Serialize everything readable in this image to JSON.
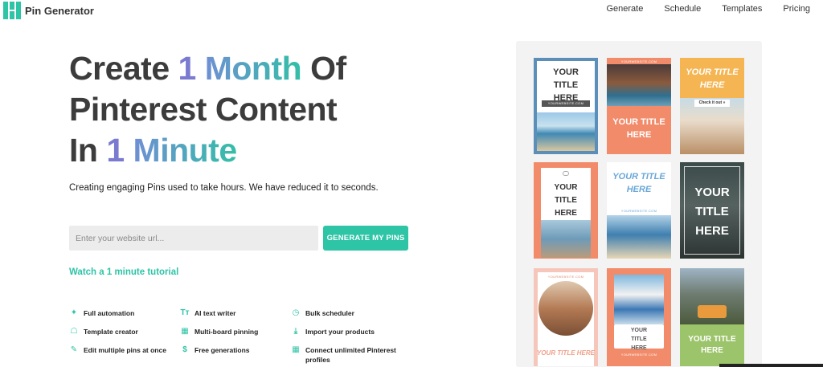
{
  "header": {
    "logo_text": "Pin Generator",
    "nav": [
      "Generate",
      "Schedule",
      "Templates",
      "Pricing"
    ]
  },
  "hero": {
    "line1": {
      "pre": "Create ",
      "num": "1",
      "word": "Month",
      "post": " Of"
    },
    "line2": "Pinterest Content",
    "line3": {
      "pre": "In ",
      "num": "1",
      "word": "Minute"
    },
    "subtitle": "Creating engaging Pins used to take hours. We have reduced it to seconds.",
    "url_placeholder": "Enter your website url...",
    "generate_label": "GENERATE MY PINS",
    "tutorial_link": "Watch a 1 minute tutorial"
  },
  "features": [
    {
      "icon": "android-icon",
      "glyph": "✦",
      "label": "Full automation"
    },
    {
      "icon": "text-icon",
      "glyph": "Tт",
      "label": "AI text writer"
    },
    {
      "icon": "clock-icon",
      "glyph": "◷",
      "label": "Bulk scheduler"
    },
    {
      "icon": "person-icon",
      "glyph": "☖",
      "label": "Template creator"
    },
    {
      "icon": "grid-icon",
      "glyph": "▦",
      "label": "Multi-board pinning"
    },
    {
      "icon": "download-icon",
      "glyph": "⤓",
      "label": "Import your products"
    },
    {
      "icon": "brush-icon",
      "glyph": "✎",
      "label": "Edit multiple pins at once"
    },
    {
      "icon": "dollar-icon",
      "glyph": "$",
      "label": "Free generations"
    },
    {
      "icon": "boards-icon",
      "glyph": "▦",
      "label": "Connect unlimited Pinterest profiles"
    }
  ],
  "pins": {
    "p1": {
      "title": "YOUR TITLE HERE",
      "site": "YOURWEBSITE.COM"
    },
    "p2": {
      "title": "YOUR TITLE HERE",
      "site": "YOURWEBSITE.COM"
    },
    "p3": {
      "title": "YOUR TITLE HERE",
      "badge": "Check it out »"
    },
    "p4": {
      "title": "YOUR TITLE HERE"
    },
    "p5": {
      "title": "YOUR TITLE HERE",
      "site": "YOURWEBSITE.COM"
    },
    "p6": {
      "title": "YOUR TITLE HERE"
    },
    "p7": {
      "title": "YOUR TITLE HERE",
      "site": "YOURWEBSITE.COM"
    },
    "p8": {
      "title": "YOUR TITLE HERE",
      "site": "YOURWEBSITE.COM"
    },
    "p9": {
      "title": "YOUR TITLE HERE"
    }
  },
  "colors": {
    "accent": "#2ec4a6",
    "headline_dark": "#3c3c3c",
    "number_purple": "#7a7bd0"
  }
}
